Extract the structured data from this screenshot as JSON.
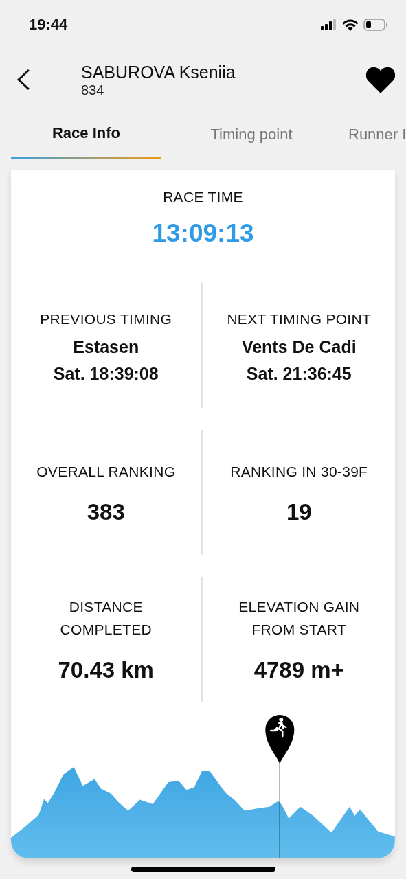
{
  "status_bar": {
    "time": "19:44"
  },
  "header": {
    "name": "SABUROVA Kseniia",
    "bib": "834",
    "favorite": true
  },
  "tabs": [
    {
      "label": "Race Info",
      "selected": true
    },
    {
      "label": "Timing point",
      "selected": false
    },
    {
      "label": "Runner I",
      "selected": false
    }
  ],
  "race_time": {
    "label": "RACE TIME",
    "value": "13:09:13"
  },
  "stats": [
    {
      "label": "PREVIOUS TIMING",
      "place": "Estasen",
      "time": "Sat. 18:39:08"
    },
    {
      "label": "NEXT TIMING POINT",
      "place": "Vents De Cadi",
      "time": "Sat. 21:36:45"
    },
    {
      "label": "OVERALL RANKING",
      "value": "383"
    },
    {
      "label": "RANKING IN 30-39F",
      "value": "19"
    },
    {
      "label": "DISTANCE\nCOMPLETED",
      "value": "70.43 km"
    },
    {
      "label": "ELEVATION GAIN\nFROM START",
      "value": "4789 m+"
    }
  ],
  "elevation_profile": {
    "runner_position": {
      "level": 0.7
    }
  }
}
